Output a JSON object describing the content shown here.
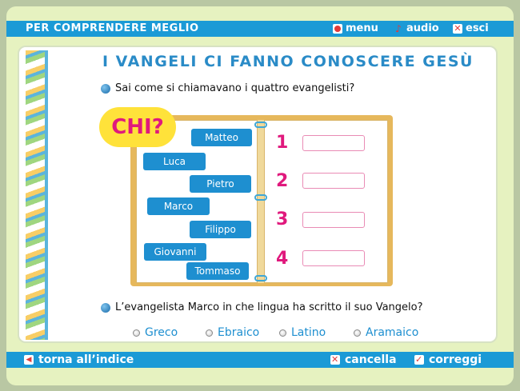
{
  "header": {
    "title": "PER COMPRENDERE MEGLIO",
    "menu_label": "menu",
    "audio_label": "audio",
    "exit_label": "esci"
  },
  "main": {
    "heading": "I VANGELI CI FANNO CONOSCERE GESÙ",
    "question1": "Sai come si chiamavano i quattro evangelisti?",
    "chi_label": "CHI?",
    "names": [
      "Matteo",
      "Luca",
      "Pietro",
      "Marco",
      "Filippo",
      "Giovanni",
      "Tommaso"
    ],
    "numbers": [
      "1",
      "2",
      "3",
      "4"
    ],
    "question2": "L’evangelista Marco in che lingua ha scritto il suo Vangelo?",
    "options": [
      "Greco",
      "Ebraico",
      "Latino",
      "Aramaico"
    ]
  },
  "footer": {
    "back_label": "torna all’indice",
    "clear_label": "cancella",
    "check_label": "correggi"
  },
  "colors": {
    "accent": "#1b9ad6",
    "magenta": "#e0197d",
    "yellow": "#ffe23a"
  }
}
